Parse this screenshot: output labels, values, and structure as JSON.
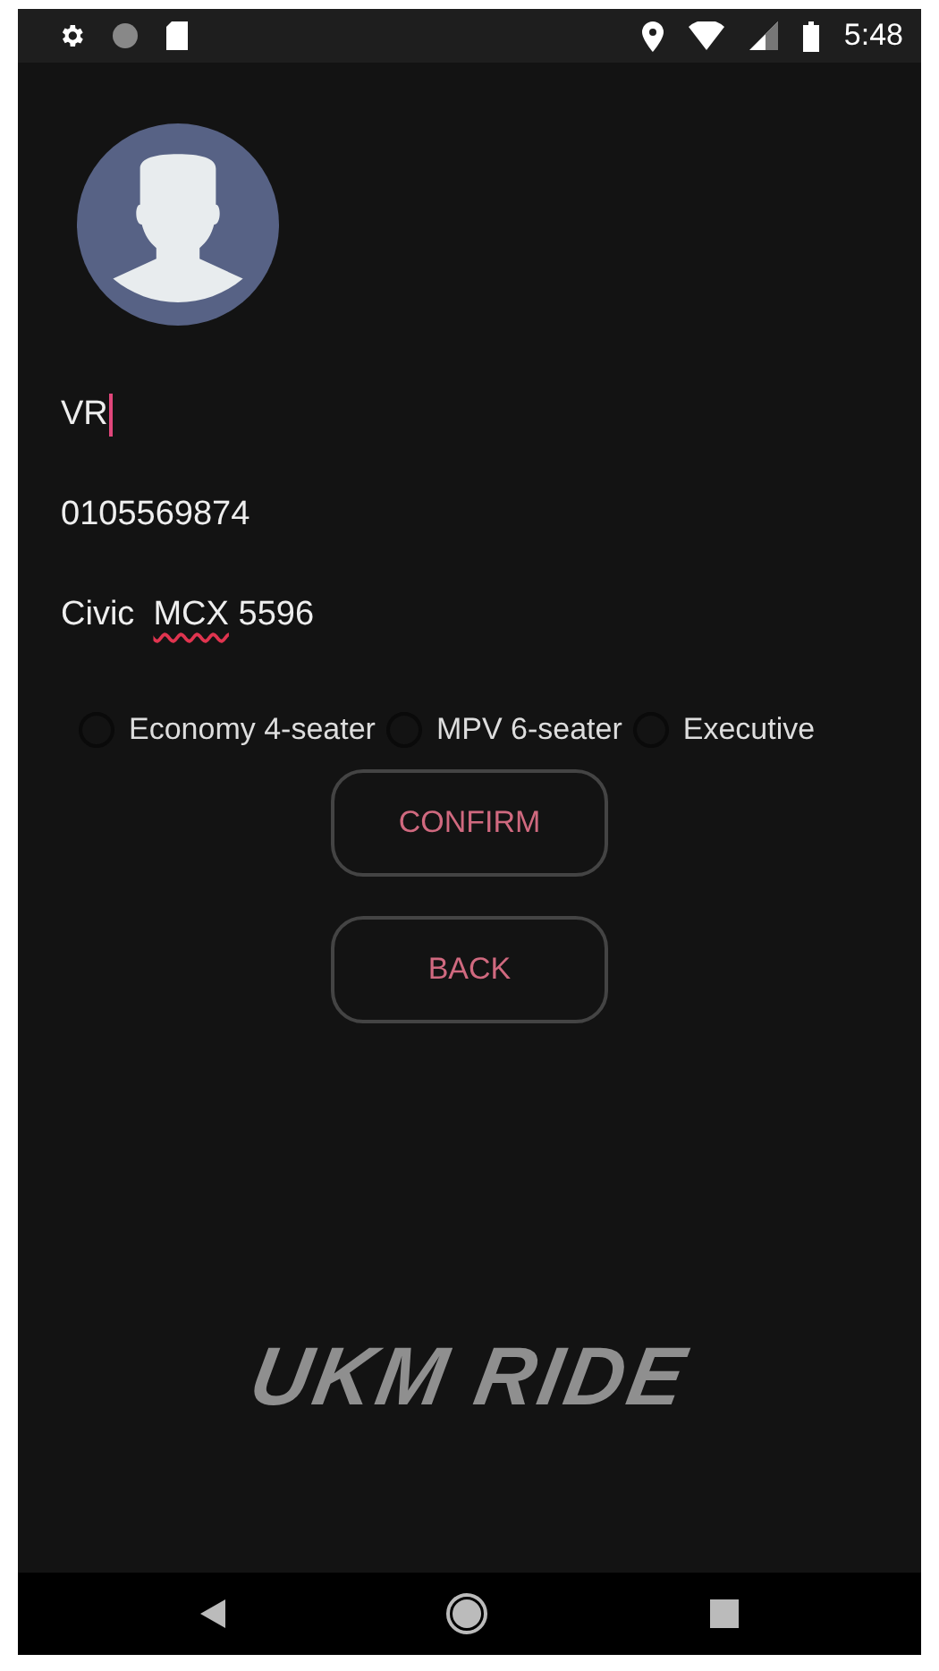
{
  "status_bar": {
    "time": "5:48"
  },
  "fields": [
    {
      "segments": [
        {
          "text": "VR",
          "flagged": false
        }
      ],
      "focused": true
    },
    {
      "segments": [
        {
          "text": "0105569874",
          "flagged": false
        }
      ],
      "focused": false
    },
    {
      "segments": [
        {
          "text": "Civic  ",
          "flagged": false
        },
        {
          "text": "MCX",
          "flagged": true
        },
        {
          "text": " 5596",
          "flagged": false
        }
      ],
      "focused": false
    }
  ],
  "vehicle_types": [
    {
      "label": "Economy 4-seater",
      "selected": false
    },
    {
      "label": "MPV 6-seater",
      "selected": false
    },
    {
      "label": "Executive",
      "selected": false
    }
  ],
  "buttons": [
    "CONFIRM",
    "BACK"
  ],
  "logo": "UKM RIDE"
}
